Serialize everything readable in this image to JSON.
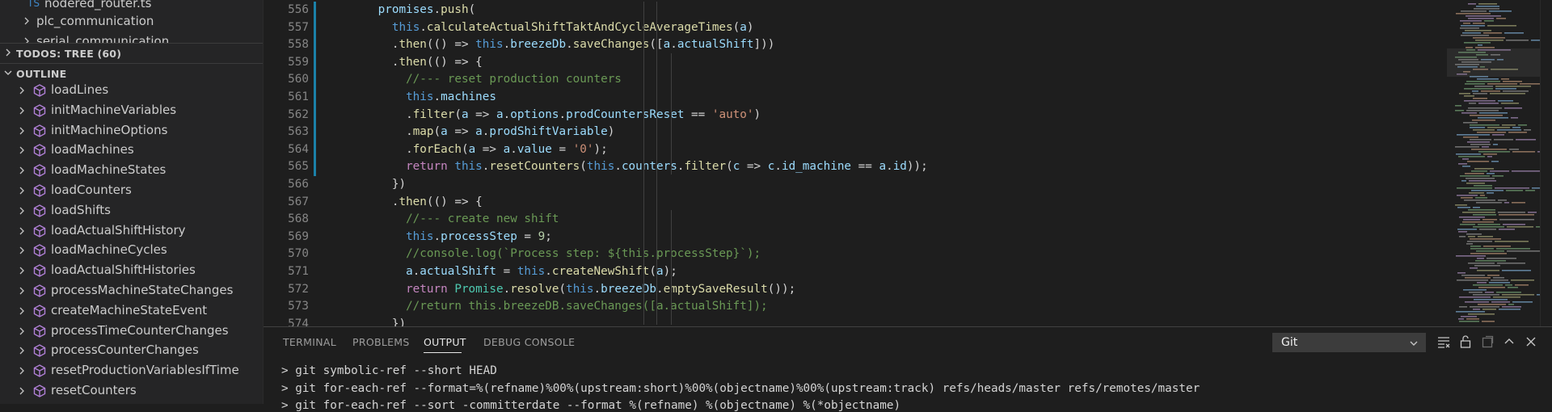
{
  "explorer": {
    "files": [
      {
        "label": "nodered_router.ts"
      },
      {
        "label": "plc_communication"
      },
      {
        "label": "serial_communication"
      }
    ]
  },
  "todos_header": "TODOS: TREE (60)",
  "outline": {
    "header": "OUTLINE",
    "items": [
      "loadLines",
      "initMachineVariables",
      "initMachineOptions",
      "loadMachines",
      "loadMachineStates",
      "loadCounters",
      "loadShifts",
      "loadActualShiftHistory",
      "loadMachineCycles",
      "loadActualShiftHistories",
      "processMachineStateChanges",
      "createMachineStateEvent",
      "processTimeCounterChanges",
      "processCounterChanges",
      "resetProductionVariablesIfTime",
      "resetCounters"
    ]
  },
  "editor": {
    "lines": [
      {
        "n": "556",
        "t": [
          [
            "      ",
            "p"
          ],
          [
            "promises",
            "prop"
          ],
          [
            ".",
            "p"
          ],
          [
            "push",
            "fn"
          ],
          [
            "(",
            "p"
          ]
        ]
      },
      {
        "n": "557",
        "t": [
          [
            "        ",
            "p"
          ],
          [
            "this",
            "this"
          ],
          [
            ".",
            "p"
          ],
          [
            "calculateActualShiftTaktAndCycleAverageTimes",
            "fn"
          ],
          [
            "(",
            "p"
          ],
          [
            "a",
            "prop"
          ],
          [
            ")",
            "p"
          ]
        ]
      },
      {
        "n": "558",
        "t": [
          [
            "        .",
            "p"
          ],
          [
            "then",
            "fn"
          ],
          [
            "(() => ",
            "p"
          ],
          [
            "this",
            "this"
          ],
          [
            ".",
            "p"
          ],
          [
            "breezeDb",
            "prop"
          ],
          [
            ".",
            "p"
          ],
          [
            "saveChanges",
            "fn"
          ],
          [
            "([",
            "p"
          ],
          [
            "a",
            "prop"
          ],
          [
            ".",
            "p"
          ],
          [
            "actualShift",
            "prop"
          ],
          [
            "]))",
            "p"
          ]
        ]
      },
      {
        "n": "559",
        "t": [
          [
            "        .",
            "p"
          ],
          [
            "then",
            "fn"
          ],
          [
            "(() => {",
            "p"
          ]
        ]
      },
      {
        "n": "560",
        "t": [
          [
            "          ",
            "p"
          ],
          [
            "//--- reset production counters",
            "cm"
          ]
        ]
      },
      {
        "n": "561",
        "t": [
          [
            "          ",
            "p"
          ],
          [
            "this",
            "this"
          ],
          [
            ".",
            "p"
          ],
          [
            "machines",
            "prop"
          ]
        ]
      },
      {
        "n": "562",
        "t": [
          [
            "          .",
            "p"
          ],
          [
            "filter",
            "fn"
          ],
          [
            "(",
            "p"
          ],
          [
            "a",
            "prop"
          ],
          [
            " => ",
            "p"
          ],
          [
            "a",
            "prop"
          ],
          [
            ".",
            "p"
          ],
          [
            "options",
            "prop"
          ],
          [
            ".",
            "p"
          ],
          [
            "prodCountersReset",
            "prop"
          ],
          [
            " == ",
            "p"
          ],
          [
            "'auto'",
            "str"
          ],
          [
            ")",
            "p"
          ]
        ]
      },
      {
        "n": "563",
        "t": [
          [
            "          .",
            "p"
          ],
          [
            "map",
            "fn"
          ],
          [
            "(",
            "p"
          ],
          [
            "a",
            "prop"
          ],
          [
            " => ",
            "p"
          ],
          [
            "a",
            "prop"
          ],
          [
            ".",
            "p"
          ],
          [
            "prodShiftVariable",
            "prop"
          ],
          [
            ")",
            "p"
          ]
        ]
      },
      {
        "n": "564",
        "t": [
          [
            "          .",
            "p"
          ],
          [
            "forEach",
            "fn"
          ],
          [
            "(",
            "p"
          ],
          [
            "a",
            "prop"
          ],
          [
            " => ",
            "p"
          ],
          [
            "a",
            "prop"
          ],
          [
            ".",
            "p"
          ],
          [
            "value",
            "prop"
          ],
          [
            " = ",
            "p"
          ],
          [
            "'0'",
            "str"
          ],
          [
            ");",
            "p"
          ]
        ]
      },
      {
        "n": "565",
        "t": [
          [
            "          ",
            "p"
          ],
          [
            "return",
            "kw"
          ],
          [
            " ",
            "p"
          ],
          [
            "this",
            "this"
          ],
          [
            ".",
            "p"
          ],
          [
            "resetCounters",
            "fn"
          ],
          [
            "(",
            "p"
          ],
          [
            "this",
            "this"
          ],
          [
            ".",
            "p"
          ],
          [
            "counters",
            "prop"
          ],
          [
            ".",
            "p"
          ],
          [
            "filter",
            "fn"
          ],
          [
            "(",
            "p"
          ],
          [
            "c",
            "prop"
          ],
          [
            " => ",
            "p"
          ],
          [
            "c",
            "prop"
          ],
          [
            ".",
            "p"
          ],
          [
            "id_machine",
            "prop"
          ],
          [
            " == ",
            "p"
          ],
          [
            "a",
            "prop"
          ],
          [
            ".",
            "p"
          ],
          [
            "id",
            "prop"
          ],
          [
            "));",
            "p"
          ]
        ]
      },
      {
        "n": "566",
        "t": [
          [
            "        })",
            "p"
          ]
        ]
      },
      {
        "n": "567",
        "t": [
          [
            "        .",
            "p"
          ],
          [
            "then",
            "fn"
          ],
          [
            "(() => {",
            "p"
          ]
        ]
      },
      {
        "n": "568",
        "t": [
          [
            "          ",
            "p"
          ],
          [
            "//--- create new shift",
            "cm"
          ]
        ]
      },
      {
        "n": "569",
        "t": [
          [
            "          ",
            "p"
          ],
          [
            "this",
            "this"
          ],
          [
            ".",
            "p"
          ],
          [
            "processStep",
            "prop"
          ],
          [
            " = ",
            "p"
          ],
          [
            "9",
            "num"
          ],
          [
            ";",
            "p"
          ]
        ]
      },
      {
        "n": "570",
        "t": [
          [
            "          ",
            "p"
          ],
          [
            "//console.log(`Process step: ${this.processStep}`);",
            "cm"
          ]
        ]
      },
      {
        "n": "571",
        "t": [
          [
            "          ",
            "p"
          ],
          [
            "a",
            "prop"
          ],
          [
            ".",
            "p"
          ],
          [
            "actualShift",
            "prop"
          ],
          [
            " = ",
            "p"
          ],
          [
            "this",
            "this"
          ],
          [
            ".",
            "p"
          ],
          [
            "createNewShift",
            "fn"
          ],
          [
            "(",
            "p"
          ],
          [
            "a",
            "prop"
          ],
          [
            ");",
            "p"
          ]
        ]
      },
      {
        "n": "572",
        "t": [
          [
            "          ",
            "p"
          ],
          [
            "return",
            "kw"
          ],
          [
            " ",
            "p"
          ],
          [
            "Promise",
            "cls"
          ],
          [
            ".",
            "p"
          ],
          [
            "resolve",
            "fn"
          ],
          [
            "(",
            "p"
          ],
          [
            "this",
            "this"
          ],
          [
            ".",
            "p"
          ],
          [
            "breezeDb",
            "prop"
          ],
          [
            ".",
            "p"
          ],
          [
            "emptySaveResult",
            "fn"
          ],
          [
            "());",
            "p"
          ]
        ]
      },
      {
        "n": "573",
        "t": [
          [
            "          ",
            "p"
          ],
          [
            "//return this.breezeDB.saveChanges([a.actualShift]);",
            "cm"
          ]
        ]
      },
      {
        "n": "574",
        "t": [
          [
            "        })",
            "p"
          ]
        ]
      }
    ]
  },
  "panel": {
    "tabs": [
      "TERMINAL",
      "PROBLEMS",
      "OUTPUT",
      "DEBUG CONSOLE"
    ],
    "active_tab": "OUTPUT",
    "channel": "Git",
    "output_lines": [
      "> git symbolic-ref --short HEAD",
      "> git for-each-ref --format=%(refname)%00%(upstream:short)%00%(objectname)%00%(upstream:track) refs/heads/master refs/remotes/master",
      "> git for-each-ref --sort -committerdate --format %(refname) %(objectname) %(*objectname)"
    ]
  },
  "icons": {
    "symbol_method": "method-cube-icon",
    "clear_output": "clear-output-icon",
    "lock_scroll": "lock-scroll-icon",
    "open_editor": "open-in-editor-icon",
    "maximize": "maximize-panel-icon",
    "close": "close-panel-icon"
  },
  "colors": {
    "symbol": "#b180d7",
    "accent_gutter": "#1b81a8"
  }
}
